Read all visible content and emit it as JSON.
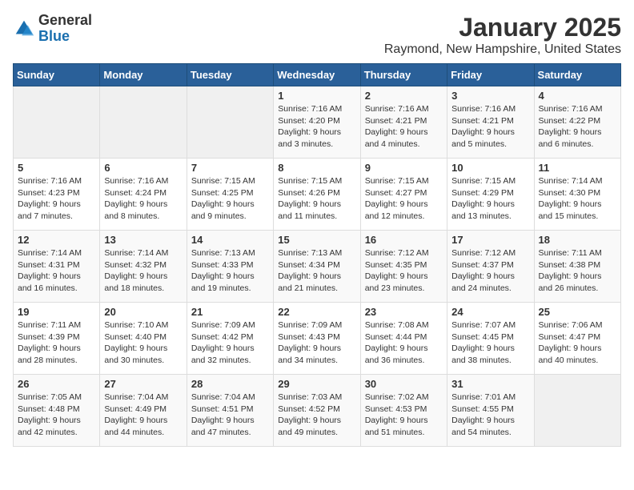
{
  "logo": {
    "general": "General",
    "blue": "Blue"
  },
  "header": {
    "month": "January 2025",
    "location": "Raymond, New Hampshire, United States"
  },
  "weekdays": [
    "Sunday",
    "Monday",
    "Tuesday",
    "Wednesday",
    "Thursday",
    "Friday",
    "Saturday"
  ],
  "weeks": [
    [
      {
        "day": "",
        "info": ""
      },
      {
        "day": "",
        "info": ""
      },
      {
        "day": "",
        "info": ""
      },
      {
        "day": "1",
        "info": "Sunrise: 7:16 AM\nSunset: 4:20 PM\nDaylight: 9 hours and 3 minutes."
      },
      {
        "day": "2",
        "info": "Sunrise: 7:16 AM\nSunset: 4:21 PM\nDaylight: 9 hours and 4 minutes."
      },
      {
        "day": "3",
        "info": "Sunrise: 7:16 AM\nSunset: 4:21 PM\nDaylight: 9 hours and 5 minutes."
      },
      {
        "day": "4",
        "info": "Sunrise: 7:16 AM\nSunset: 4:22 PM\nDaylight: 9 hours and 6 minutes."
      }
    ],
    [
      {
        "day": "5",
        "info": "Sunrise: 7:16 AM\nSunset: 4:23 PM\nDaylight: 9 hours and 7 minutes."
      },
      {
        "day": "6",
        "info": "Sunrise: 7:16 AM\nSunset: 4:24 PM\nDaylight: 9 hours and 8 minutes."
      },
      {
        "day": "7",
        "info": "Sunrise: 7:15 AM\nSunset: 4:25 PM\nDaylight: 9 hours and 9 minutes."
      },
      {
        "day": "8",
        "info": "Sunrise: 7:15 AM\nSunset: 4:26 PM\nDaylight: 9 hours and 11 minutes."
      },
      {
        "day": "9",
        "info": "Sunrise: 7:15 AM\nSunset: 4:27 PM\nDaylight: 9 hours and 12 minutes."
      },
      {
        "day": "10",
        "info": "Sunrise: 7:15 AM\nSunset: 4:29 PM\nDaylight: 9 hours and 13 minutes."
      },
      {
        "day": "11",
        "info": "Sunrise: 7:14 AM\nSunset: 4:30 PM\nDaylight: 9 hours and 15 minutes."
      }
    ],
    [
      {
        "day": "12",
        "info": "Sunrise: 7:14 AM\nSunset: 4:31 PM\nDaylight: 9 hours and 16 minutes."
      },
      {
        "day": "13",
        "info": "Sunrise: 7:14 AM\nSunset: 4:32 PM\nDaylight: 9 hours and 18 minutes."
      },
      {
        "day": "14",
        "info": "Sunrise: 7:13 AM\nSunset: 4:33 PM\nDaylight: 9 hours and 19 minutes."
      },
      {
        "day": "15",
        "info": "Sunrise: 7:13 AM\nSunset: 4:34 PM\nDaylight: 9 hours and 21 minutes."
      },
      {
        "day": "16",
        "info": "Sunrise: 7:12 AM\nSunset: 4:35 PM\nDaylight: 9 hours and 23 minutes."
      },
      {
        "day": "17",
        "info": "Sunrise: 7:12 AM\nSunset: 4:37 PM\nDaylight: 9 hours and 24 minutes."
      },
      {
        "day": "18",
        "info": "Sunrise: 7:11 AM\nSunset: 4:38 PM\nDaylight: 9 hours and 26 minutes."
      }
    ],
    [
      {
        "day": "19",
        "info": "Sunrise: 7:11 AM\nSunset: 4:39 PM\nDaylight: 9 hours and 28 minutes."
      },
      {
        "day": "20",
        "info": "Sunrise: 7:10 AM\nSunset: 4:40 PM\nDaylight: 9 hours and 30 minutes."
      },
      {
        "day": "21",
        "info": "Sunrise: 7:09 AM\nSunset: 4:42 PM\nDaylight: 9 hours and 32 minutes."
      },
      {
        "day": "22",
        "info": "Sunrise: 7:09 AM\nSunset: 4:43 PM\nDaylight: 9 hours and 34 minutes."
      },
      {
        "day": "23",
        "info": "Sunrise: 7:08 AM\nSunset: 4:44 PM\nDaylight: 9 hours and 36 minutes."
      },
      {
        "day": "24",
        "info": "Sunrise: 7:07 AM\nSunset: 4:45 PM\nDaylight: 9 hours and 38 minutes."
      },
      {
        "day": "25",
        "info": "Sunrise: 7:06 AM\nSunset: 4:47 PM\nDaylight: 9 hours and 40 minutes."
      }
    ],
    [
      {
        "day": "26",
        "info": "Sunrise: 7:05 AM\nSunset: 4:48 PM\nDaylight: 9 hours and 42 minutes."
      },
      {
        "day": "27",
        "info": "Sunrise: 7:04 AM\nSunset: 4:49 PM\nDaylight: 9 hours and 44 minutes."
      },
      {
        "day": "28",
        "info": "Sunrise: 7:04 AM\nSunset: 4:51 PM\nDaylight: 9 hours and 47 minutes."
      },
      {
        "day": "29",
        "info": "Sunrise: 7:03 AM\nSunset: 4:52 PM\nDaylight: 9 hours and 49 minutes."
      },
      {
        "day": "30",
        "info": "Sunrise: 7:02 AM\nSunset: 4:53 PM\nDaylight: 9 hours and 51 minutes."
      },
      {
        "day": "31",
        "info": "Sunrise: 7:01 AM\nSunset: 4:55 PM\nDaylight: 9 hours and 54 minutes."
      },
      {
        "day": "",
        "info": ""
      }
    ]
  ]
}
